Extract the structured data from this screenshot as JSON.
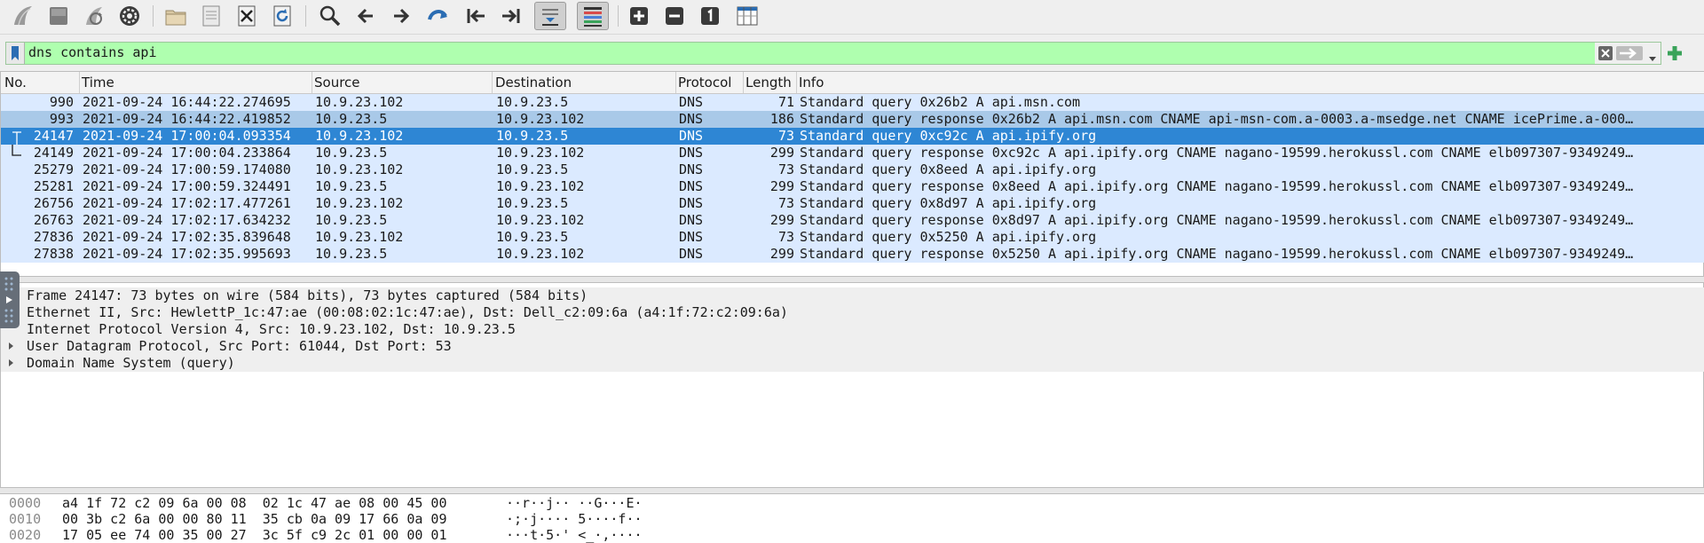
{
  "toolbar": {
    "buttons": [
      {
        "name": "start-capture-icon"
      },
      {
        "name": "stop-capture-icon"
      },
      {
        "name": "restart-capture-icon"
      },
      {
        "name": "capture-options-icon"
      },
      {
        "name": "open-file-icon"
      },
      {
        "name": "save-file-icon"
      },
      {
        "name": "close-file-icon"
      },
      {
        "name": "reload-file-icon"
      },
      {
        "name": "find-packet-icon"
      },
      {
        "name": "go-back-icon"
      },
      {
        "name": "go-forward-icon"
      },
      {
        "name": "go-to-packet-icon"
      },
      {
        "name": "first-packet-icon"
      },
      {
        "name": "last-packet-icon"
      },
      {
        "name": "autoscroll-icon"
      },
      {
        "name": "colorize-icon"
      },
      {
        "name": "zoom-in-icon"
      },
      {
        "name": "zoom-out-icon"
      },
      {
        "name": "normal-size-icon"
      },
      {
        "name": "resize-columns-icon"
      }
    ]
  },
  "filter": {
    "value": "dns contains api"
  },
  "columns": [
    "No.",
    "Time",
    "Source",
    "Destination",
    "Protocol",
    "Length",
    "Info"
  ],
  "packets": [
    {
      "no": "990",
      "time": "2021-09-24 16:44:22.274695",
      "src": "10.9.23.102",
      "dst": "10.9.23.5",
      "proto": "DNS",
      "len": "71",
      "info": "Standard query 0x26b2 A api.msn.com"
    },
    {
      "no": "993",
      "time": "2021-09-24 16:44:22.419852",
      "src": "10.9.23.5",
      "dst": "10.9.23.102",
      "proto": "DNS",
      "len": "186",
      "info": "Standard query response 0x26b2 A api.msn.com CNAME api-msn-com.a-0003.a-msedge.net CNAME icePrime.a-000…"
    },
    {
      "no": "24147",
      "time": "2021-09-24 17:00:04.093354",
      "src": "10.9.23.102",
      "dst": "10.9.23.5",
      "proto": "DNS",
      "len": "73",
      "info": "Standard query 0xc92c A api.ipify.org"
    },
    {
      "no": "24149",
      "time": "2021-09-24 17:00:04.233864",
      "src": "10.9.23.5",
      "dst": "10.9.23.102",
      "proto": "DNS",
      "len": "299",
      "info": "Standard query response 0xc92c A api.ipify.org CNAME nagano-19599.herokussl.com CNAME elb097307-9349249…"
    },
    {
      "no": "25279",
      "time": "2021-09-24 17:00:59.174080",
      "src": "10.9.23.102",
      "dst": "10.9.23.5",
      "proto": "DNS",
      "len": "73",
      "info": "Standard query 0x8eed A api.ipify.org"
    },
    {
      "no": "25281",
      "time": "2021-09-24 17:00:59.324491",
      "src": "10.9.23.5",
      "dst": "10.9.23.102",
      "proto": "DNS",
      "len": "299",
      "info": "Standard query response 0x8eed A api.ipify.org CNAME nagano-19599.herokussl.com CNAME elb097307-9349249…"
    },
    {
      "no": "26756",
      "time": "2021-09-24 17:02:17.477261",
      "src": "10.9.23.102",
      "dst": "10.9.23.5",
      "proto": "DNS",
      "len": "73",
      "info": "Standard query 0x8d97 A api.ipify.org"
    },
    {
      "no": "26763",
      "time": "2021-09-24 17:02:17.634232",
      "src": "10.9.23.5",
      "dst": "10.9.23.102",
      "proto": "DNS",
      "len": "299",
      "info": "Standard query response 0x8d97 A api.ipify.org CNAME nagano-19599.herokussl.com CNAME elb097307-9349249…"
    },
    {
      "no": "27836",
      "time": "2021-09-24 17:02:35.839648",
      "src": "10.9.23.102",
      "dst": "10.9.23.5",
      "proto": "DNS",
      "len": "73",
      "info": "Standard query 0x5250 A api.ipify.org"
    },
    {
      "no": "27838",
      "time": "2021-09-24 17:02:35.995693",
      "src": "10.9.23.5",
      "dst": "10.9.23.102",
      "proto": "DNS",
      "len": "299",
      "info": "Standard query response 0x5250 A api.ipify.org CNAME nagano-19599.herokussl.com CNAME elb097307-9349249…"
    }
  ],
  "row_state": {
    "selected_index": 2,
    "related_index": 1
  },
  "colors": {
    "row_bg": "#dbeaff",
    "related_bg": "#a9c9e8",
    "selected_bg": "#2e86d4",
    "selected_fg": "#ffffff",
    "filter_bg": "#afffaf"
  },
  "details": [
    {
      "text": "Frame 24147: 73 bytes on wire (584 bits), 73 bytes captured (584 bits)",
      "expandable": false
    },
    {
      "text": "Ethernet II, Src: HewlettP_1c:47:ae (00:08:02:1c:47:ae), Dst: Dell_c2:09:6a (a4:1f:72:c2:09:6a)",
      "expandable": false
    },
    {
      "text": "Internet Protocol Version 4, Src: 10.9.23.102, Dst: 10.9.23.5",
      "expandable": false
    },
    {
      "text": "User Datagram Protocol, Src Port: 61044, Dst Port: 53",
      "expandable": true
    },
    {
      "text": "Domain Name System (query)",
      "expandable": true
    }
  ],
  "bytes": [
    {
      "offset": "0000",
      "hex": "a4 1f 72 c2 09 6a 00 08  02 1c 47 ae 08 00 45 00",
      "ascii": "··r··j·· ··G···E·"
    },
    {
      "offset": "0010",
      "hex": "00 3b c2 6a 00 00 80 11  35 cb 0a 09 17 66 0a 09",
      "ascii": "·;·j···· 5····f··"
    },
    {
      "offset": "0020",
      "hex": "17 05 ee 74 00 35 00 27  3c 5f c9 2c 01 00 00 01",
      "ascii": "···t·5·' <_·,····"
    }
  ]
}
